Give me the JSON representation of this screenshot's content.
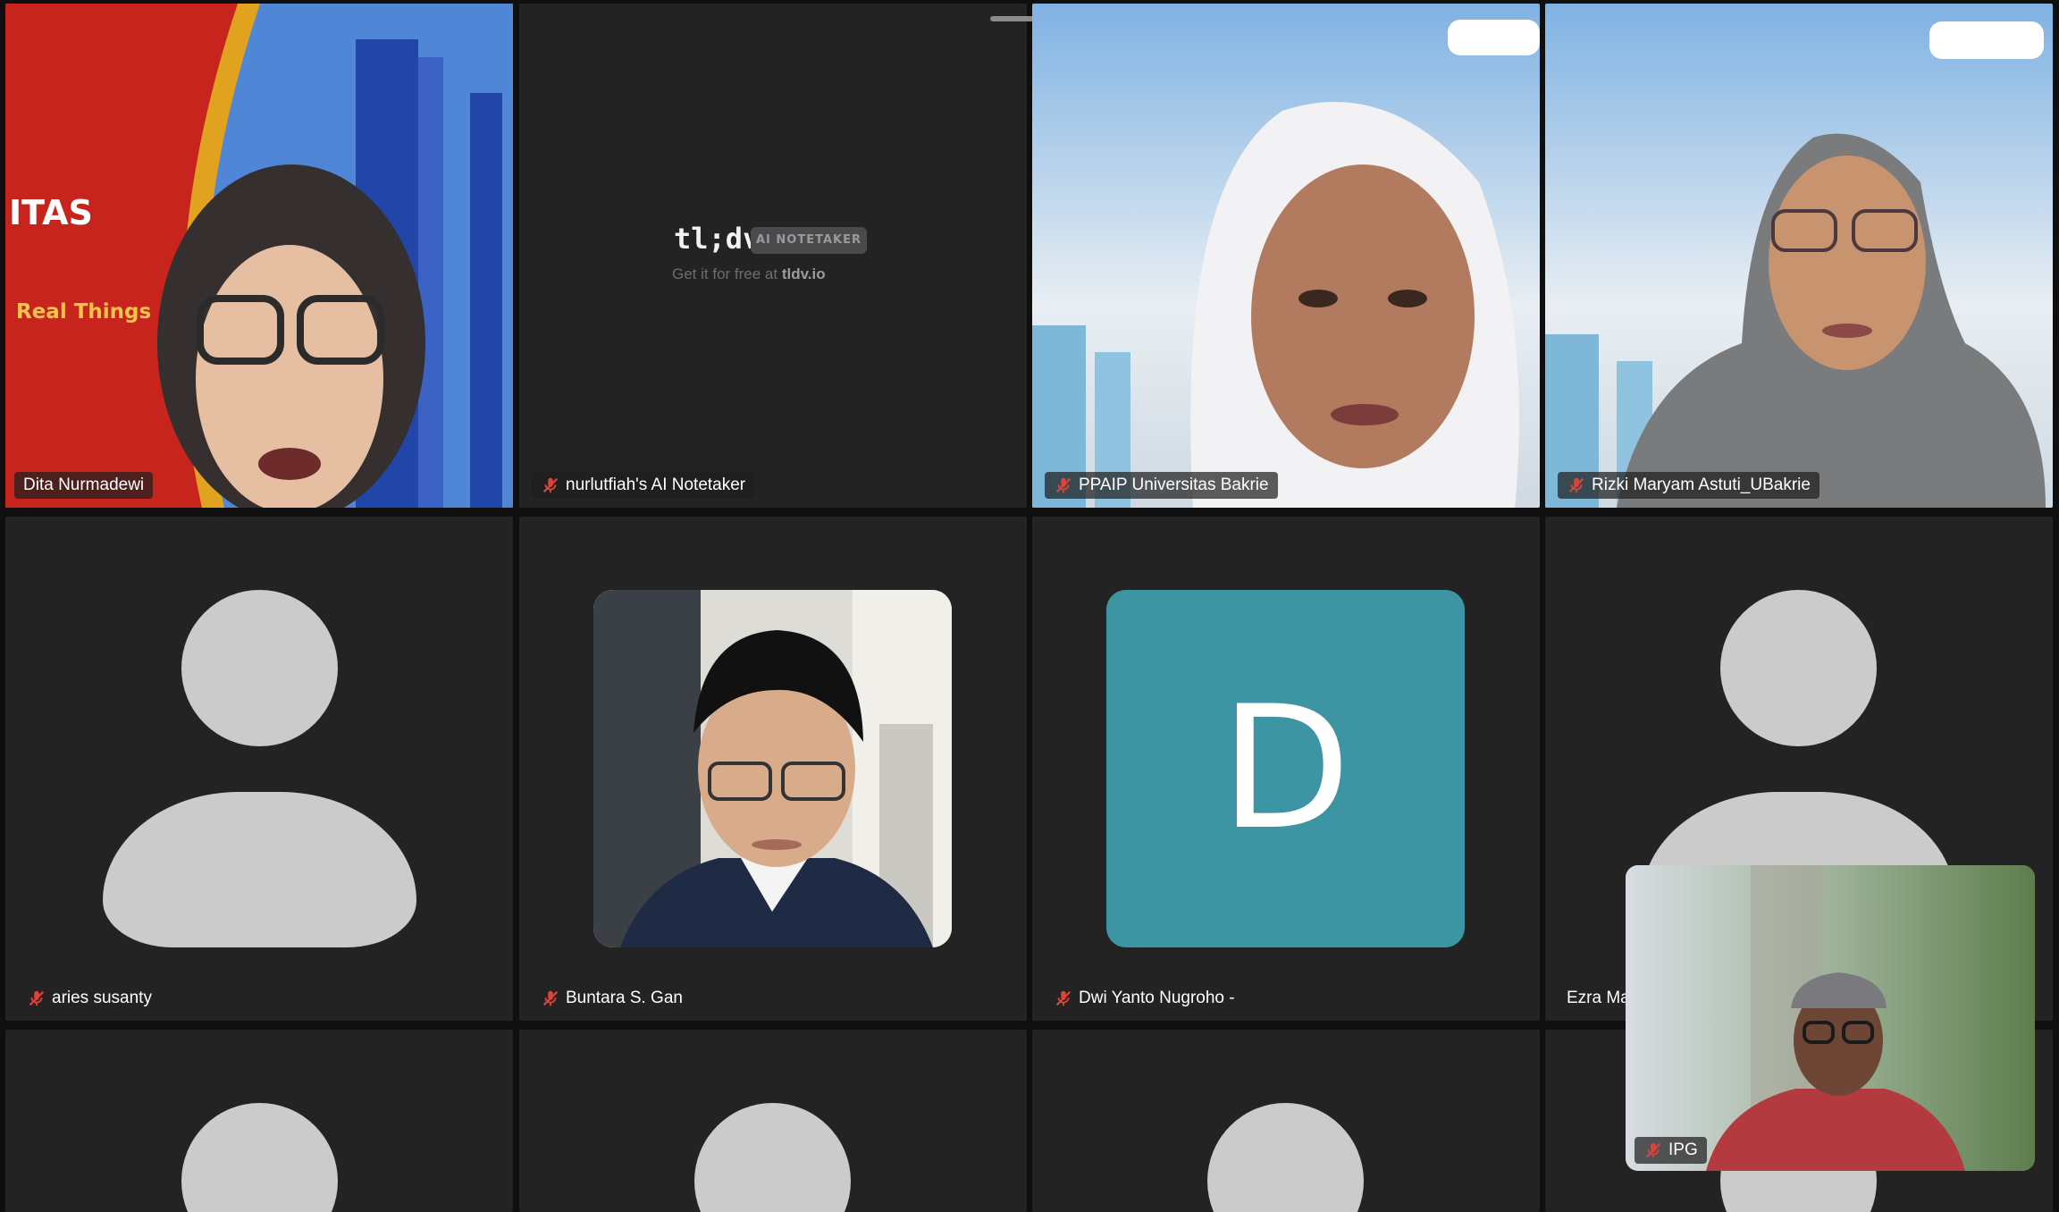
{
  "participants": [
    {
      "name": "Dita Nurmadewi",
      "muted": false,
      "speaking": true
    },
    {
      "name": "nurlutfiah's AI Notetaker",
      "muted": true
    },
    {
      "name": "PPAIP Universitas Bakrie",
      "muted": true
    },
    {
      "name": "Rizki Maryam Astuti_UBakrie",
      "muted": true
    },
    {
      "name": "aries susanty",
      "muted": true
    },
    {
      "name": "Buntara S. Gan",
      "muted": true
    },
    {
      "name": "Dwi Yanto Nugroho -",
      "muted": true
    },
    {
      "name": "Ezra Ma",
      "muted": false
    },
    {
      "name": "IPG",
      "muted": true
    }
  ],
  "slide_text": {
    "line1": "ITAS",
    "line2": "Real Things"
  },
  "tldv": {
    "logo": "tl;dv",
    "badge": "AI NOTETAKER",
    "sub_prefix": "Get it for free at ",
    "sub_link": "tldv.io"
  },
  "initial_avatar": {
    "letter": "D",
    "color": "#3d95a4"
  },
  "colors": {
    "speaking_border": "#6ccf5e",
    "tile_bg": "#232324",
    "mic_off": "#e0423a"
  },
  "icons": [
    "microphone-off-icon",
    "drag-handle-icon"
  ]
}
